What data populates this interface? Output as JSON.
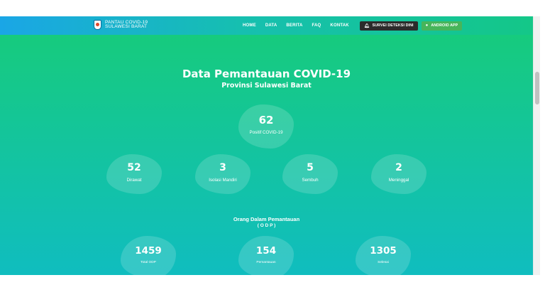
{
  "brand": {
    "line1": "PANTAU COVID-19",
    "line2": "SULAWESI BARAT"
  },
  "nav": {
    "home": "HOME",
    "data": "DATA",
    "berita": "BERITA",
    "faq": "FAQ",
    "kontak": "KONTAK",
    "survei_button": "SURVEI DETEKSI DINI",
    "android_button": "ANDROID APP"
  },
  "hero": {
    "title": "Data Pemantauan COVID-19",
    "subtitle": "Provinsi Sulawesi Barat"
  },
  "positif": {
    "value": "62",
    "label": "Positif COVID-19"
  },
  "cases": [
    {
      "value": "52",
      "label": "Dirawat"
    },
    {
      "value": "3",
      "label": "Isolasi Mandiri"
    },
    {
      "value": "5",
      "label": "Sembuh"
    },
    {
      "value": "2",
      "label": "Meninggal"
    }
  ],
  "odp": {
    "title": "Orang Dalam Pemantauan",
    "subtitle": "( O D P )",
    "stats": [
      {
        "value": "1459",
        "label": "Total ODP"
      },
      {
        "value": "154",
        "label": "Pemantauan"
      },
      {
        "value": "1305",
        "label": "Selesai"
      }
    ]
  },
  "icons": {
    "survei": "bell-icon",
    "android": "android-icon",
    "logo": "emblem-icon"
  },
  "colors": {
    "gradient_top": "#17cc78",
    "gradient_bottom": "#10bdbf",
    "survei_button": "#2b2b2b",
    "android_button": "#47b55a"
  }
}
